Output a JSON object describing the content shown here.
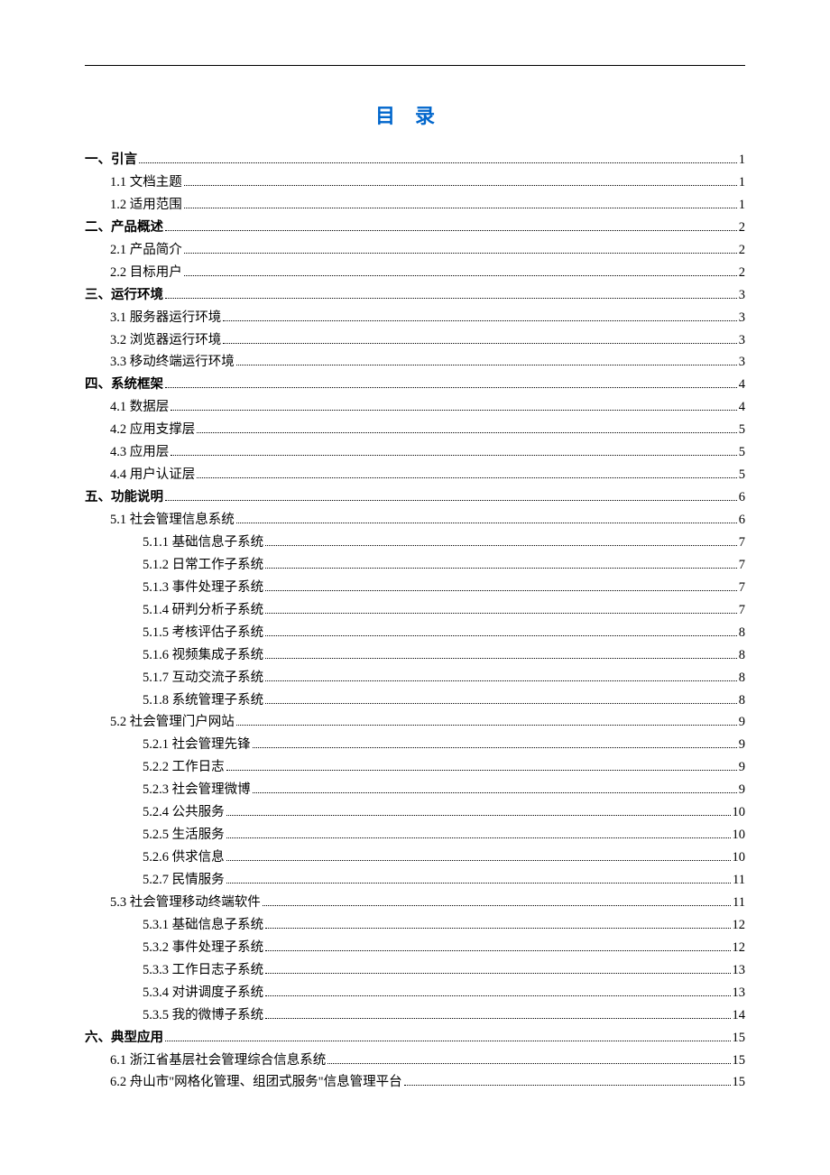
{
  "title": "目录",
  "entries": [
    {
      "level": 1,
      "label": "一、引言",
      "page": "1"
    },
    {
      "level": 2,
      "label": "1.1  文档主题",
      "page": "1"
    },
    {
      "level": 2,
      "label": "1.2  适用范围",
      "page": "1"
    },
    {
      "level": 1,
      "label": "二、产品概述",
      "page": "2"
    },
    {
      "level": 2,
      "label": "2.1 产品简介",
      "page": "2"
    },
    {
      "level": 2,
      "label": "2.2 目标用户",
      "page": "2"
    },
    {
      "level": 1,
      "label": "三、运行环境",
      "page": "3"
    },
    {
      "level": 2,
      "label": "3.1 服务器运行环境",
      "page": "3"
    },
    {
      "level": 2,
      "label": "3.2 浏览器运行环境",
      "page": "3"
    },
    {
      "level": 2,
      "label": "3.3 移动终端运行环境",
      "page": "3"
    },
    {
      "level": 1,
      "label": "四、系统框架",
      "page": "4"
    },
    {
      "level": 2,
      "label": "4.1 数据层",
      "page": "4"
    },
    {
      "level": 2,
      "label": "4.2 应用支撑层",
      "page": "5"
    },
    {
      "level": 2,
      "label": "4.3 应用层",
      "page": "5"
    },
    {
      "level": 2,
      "label": "4.4 用户认证层",
      "page": "5"
    },
    {
      "level": 1,
      "label": "五、功能说明",
      "page": "6"
    },
    {
      "level": 2,
      "label": "5.1 社会管理信息系统",
      "page": "6"
    },
    {
      "level": 3,
      "label": "5.1.1 基础信息子系统",
      "page": "7"
    },
    {
      "level": 3,
      "label": "5.1.2 日常工作子系统",
      "page": "7"
    },
    {
      "level": 3,
      "label": "5.1.3 事件处理子系统",
      "page": "7"
    },
    {
      "level": 3,
      "label": "5.1.4 研判分析子系统",
      "page": "7"
    },
    {
      "level": 3,
      "label": "5.1.5 考核评估子系统",
      "page": "8"
    },
    {
      "level": 3,
      "label": "5.1.6 视频集成子系统",
      "page": "8"
    },
    {
      "level": 3,
      "label": "5.1.7 互动交流子系统",
      "page": "8"
    },
    {
      "level": 3,
      "label": "5.1.8 系统管理子系统",
      "page": "8"
    },
    {
      "level": 2,
      "label": "5.2 社会管理门户网站",
      "page": "9"
    },
    {
      "level": 3,
      "label": "5.2.1 社会管理先锋",
      "page": "9"
    },
    {
      "level": 3,
      "label": "5.2.2 工作日志",
      "page": "9"
    },
    {
      "level": 3,
      "label": "5.2.3 社会管理微博",
      "page": "9"
    },
    {
      "level": 3,
      "label": "5.2.4 公共服务",
      "page": "10"
    },
    {
      "level": 3,
      "label": "5.2.5 生活服务",
      "page": "10"
    },
    {
      "level": 3,
      "label": "5.2.6 供求信息",
      "page": "10"
    },
    {
      "level": 3,
      "label": "5.2.7 民情服务",
      "page": "11"
    },
    {
      "level": 2,
      "label": "5.3 社会管理移动终端软件",
      "page": "11"
    },
    {
      "level": 3,
      "label": "5.3.1 基础信息子系统",
      "page": "12"
    },
    {
      "level": 3,
      "label": "5.3.2 事件处理子系统",
      "page": "12"
    },
    {
      "level": 3,
      "label": "5.3.3 工作日志子系统",
      "page": "13"
    },
    {
      "level": 3,
      "label": "5.3.4 对讲调度子系统",
      "page": "13"
    },
    {
      "level": 3,
      "label": "5.3.5 我的微博子系统",
      "page": "14"
    },
    {
      "level": 1,
      "label": "六、典型应用",
      "page": "15"
    },
    {
      "level": 2,
      "label": "6.1 浙江省基层社会管理综合信息系统",
      "page": "15"
    },
    {
      "level": 2,
      "label": "6.2 舟山市\"网格化管理、组团式服务\"信息管理平台",
      "page": "15"
    }
  ]
}
